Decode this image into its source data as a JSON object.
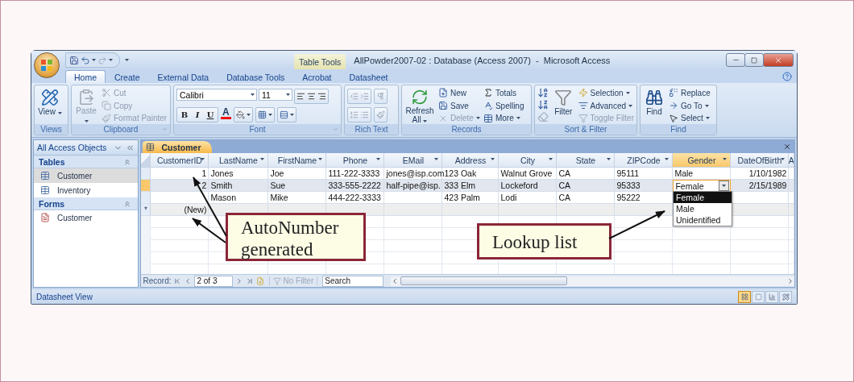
{
  "window": {
    "title": "AllPowder2007-02 : Database (Access 2007)  -  Microsoft Access",
    "context_label": "Table Tools"
  },
  "ribbon_tabs": [
    {
      "label": "Home",
      "selected": true
    },
    {
      "label": "Create",
      "selected": false
    },
    {
      "label": "External Data",
      "selected": false
    },
    {
      "label": "Database Tools",
      "selected": false
    },
    {
      "label": "Acrobat",
      "selected": false
    },
    {
      "label": "Datasheet",
      "selected": false
    }
  ],
  "ribbon_groups": [
    {
      "kind": "views",
      "name": "Views",
      "commands": [
        {
          "label": "View",
          "disabled": false,
          "dropdown": true
        }
      ]
    },
    {
      "kind": "clipboard",
      "name": "Clipboard",
      "commands": [
        {
          "label": "Paste",
          "disabled": true,
          "dropdown": true
        },
        {
          "label": "Cut",
          "disabled": true,
          "dropdown": false
        },
        {
          "label": "Copy",
          "disabled": true,
          "dropdown": false
        },
        {
          "label": "Format Painter",
          "disabled": true,
          "dropdown": false
        }
      ]
    },
    {
      "kind": "font",
      "name": "Font",
      "font": "Calibri",
      "size": "11",
      "format_buttons": [
        "B",
        "I",
        "U"
      ],
      "color_button": "A"
    },
    {
      "kind": "rich_text",
      "name": "Rich Text"
    },
    {
      "kind": "records",
      "name": "Records",
      "commands": [
        {
          "label": "Refresh All",
          "disabled": false,
          "dropdown": true
        },
        {
          "label": "New",
          "disabled": false,
          "dropdown": false
        },
        {
          "label": "Save",
          "disabled": false,
          "dropdown": false
        },
        {
          "label": "Delete",
          "disabled": true,
          "dropdown": true
        },
        {
          "label": "Totals",
          "disabled": false,
          "dropdown": false
        },
        {
          "label": "Spelling",
          "disabled": false,
          "dropdown": false
        },
        {
          "label": "More",
          "disabled": false,
          "dropdown": true
        }
      ]
    },
    {
      "kind": "sort_filter",
      "name": "Sort & Filter",
      "commands": [
        {
          "label": "Filter",
          "disabled": false,
          "dropdown": false
        },
        {
          "label": "Selection",
          "disabled": false,
          "dropdown": true
        },
        {
          "label": "Advanced",
          "disabled": false,
          "dropdown": true
        },
        {
          "label": "Toggle Filter",
          "disabled": true,
          "dropdown": false
        }
      ]
    },
    {
      "kind": "find",
      "name": "Find",
      "commands": [
        {
          "label": "Find",
          "disabled": false,
          "dropdown": false
        },
        {
          "label": "Replace",
          "disabled": false,
          "dropdown": false
        },
        {
          "label": "Go To",
          "disabled": false,
          "dropdown": true
        },
        {
          "label": "Select",
          "disabled": false,
          "dropdown": true
        }
      ]
    }
  ],
  "nav_pane": {
    "title": "All Access Objects",
    "sections": [
      {
        "title": "Tables",
        "items": [
          {
            "label": "Customer",
            "selected": true
          },
          {
            "label": "Inventory",
            "selected": false
          }
        ]
      },
      {
        "title": "Forms",
        "items": [
          {
            "label": "Customer",
            "selected": false
          }
        ]
      }
    ]
  },
  "document_tab": {
    "label": "Customer"
  },
  "table": {
    "columns": [
      {
        "label": "CustomerID",
        "kind": "number",
        "selected": false
      },
      {
        "label": "LastName",
        "kind": "text",
        "selected": false
      },
      {
        "label": "FirstName",
        "kind": "text",
        "selected": false
      },
      {
        "label": "Phone",
        "kind": "text",
        "selected": false
      },
      {
        "label": "EMail",
        "kind": "text",
        "selected": false
      },
      {
        "label": "Address",
        "kind": "text",
        "selected": false
      },
      {
        "label": "City",
        "kind": "text",
        "selected": false
      },
      {
        "label": "State",
        "kind": "text",
        "selected": false
      },
      {
        "label": "ZIPCode",
        "kind": "text",
        "selected": false
      },
      {
        "label": "Gender",
        "kind": "text",
        "selected": true
      },
      {
        "label": "DateOfBirth",
        "kind": "date",
        "selected": false
      },
      {
        "label": "A",
        "kind": "text",
        "selected": false
      }
    ],
    "rows": [
      {
        "selected": false,
        "cells": [
          "1",
          "Jones",
          "Joe",
          "111-222-3333",
          "jones@isp.com",
          "123 Oak",
          "Walnut Grove",
          "CA",
          "95111",
          "Male",
          "1/10/1982"
        ]
      },
      {
        "selected": true,
        "cells": [
          "2",
          "Smith",
          "Sue",
          "333-555-2222",
          "half-pipe@isp.",
          "333 Elm",
          "Lockeford",
          "CA",
          "95333",
          "Female",
          "2/15/1989"
        ],
        "open_lookup": {
          "options": [
            {
              "label": "Female",
              "selected": true
            },
            {
              "label": "Male",
              "selected": false
            },
            {
              "label": "Unidentified",
              "selected": false
            }
          ]
        }
      },
      {
        "selected": false,
        "cells": [
          null,
          "Mason",
          "Mike",
          "444-222-3333",
          null,
          "423 Palm",
          "Lodi",
          "CA",
          "95222",
          null,
          null
        ]
      }
    ],
    "new_row": {
      "marker": "*",
      "label": "(New)"
    }
  },
  "record_nav": {
    "label": "Record:",
    "position": "2 of 3",
    "filter": "No Filter",
    "search_placeholder": "Search"
  },
  "status_bar": {
    "text": "Datasheet View"
  },
  "callouts": [
    {
      "text": "AutoNumber generated"
    },
    {
      "text": "Lookup list"
    }
  ]
}
